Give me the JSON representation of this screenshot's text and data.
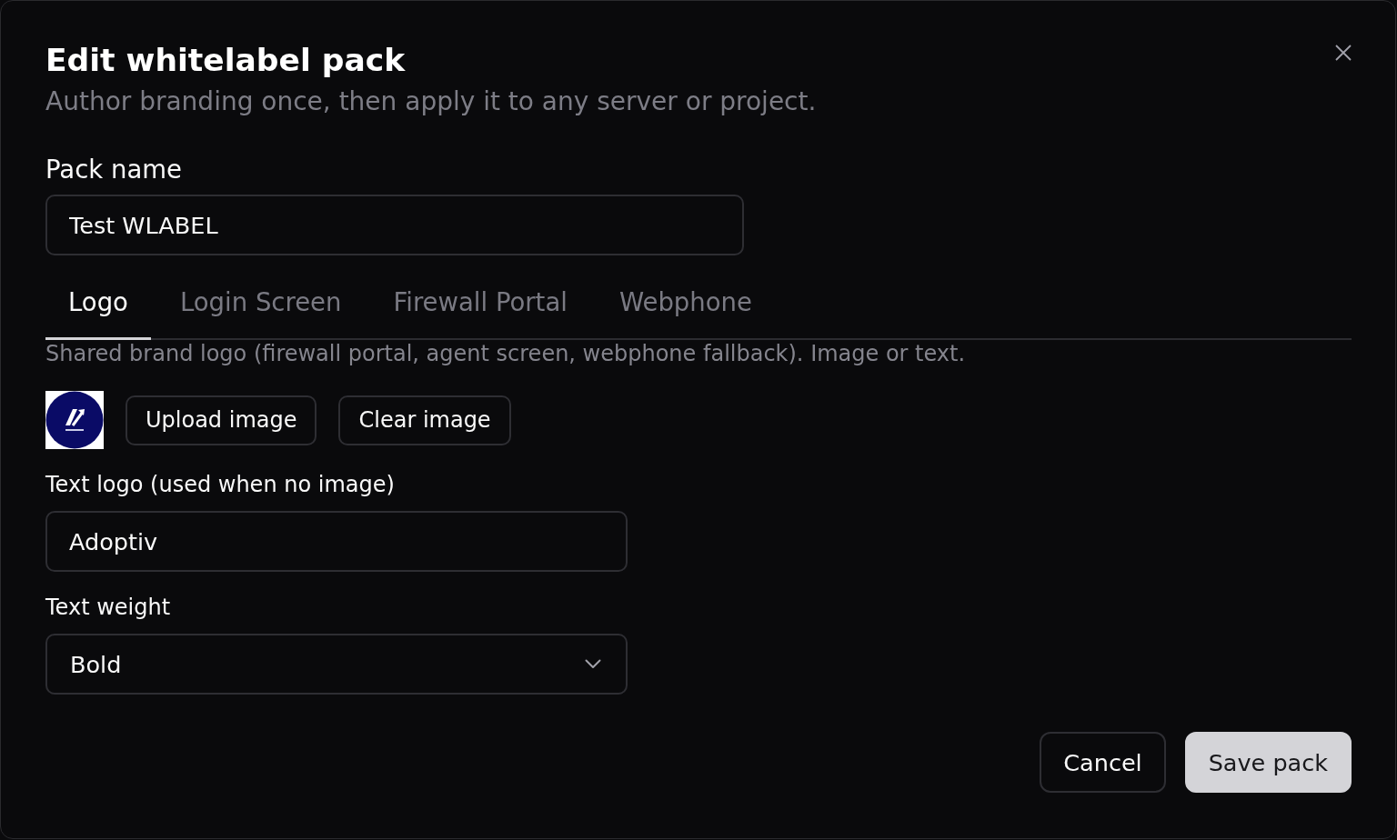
{
  "dialog": {
    "title": "Edit whitelabel pack",
    "subtitle": "Author branding once, then apply it to any server or project."
  },
  "pack_name": {
    "label": "Pack name",
    "value": "Test WLABEL"
  },
  "tabs": [
    {
      "label": "Logo",
      "selected": true
    },
    {
      "label": "Login Screen",
      "selected": false
    },
    {
      "label": "Firewall Portal",
      "selected": false
    },
    {
      "label": "Webphone",
      "selected": false
    }
  ],
  "logo_panel": {
    "description": "Shared brand logo (firewall portal, agent screen, webphone fallback). Image or text.",
    "image_buttons": [
      "Upload image",
      "Clear image"
    ],
    "text_logo": {
      "label": "Text logo (used when no image)",
      "value": "Adoptiv"
    },
    "text_weight": {
      "label": "Text weight",
      "value": "Bold"
    }
  },
  "footer_buttons": [
    {
      "label": "Cancel",
      "kind": "secondary"
    },
    {
      "label": "Save pack",
      "kind": "primary"
    }
  ]
}
